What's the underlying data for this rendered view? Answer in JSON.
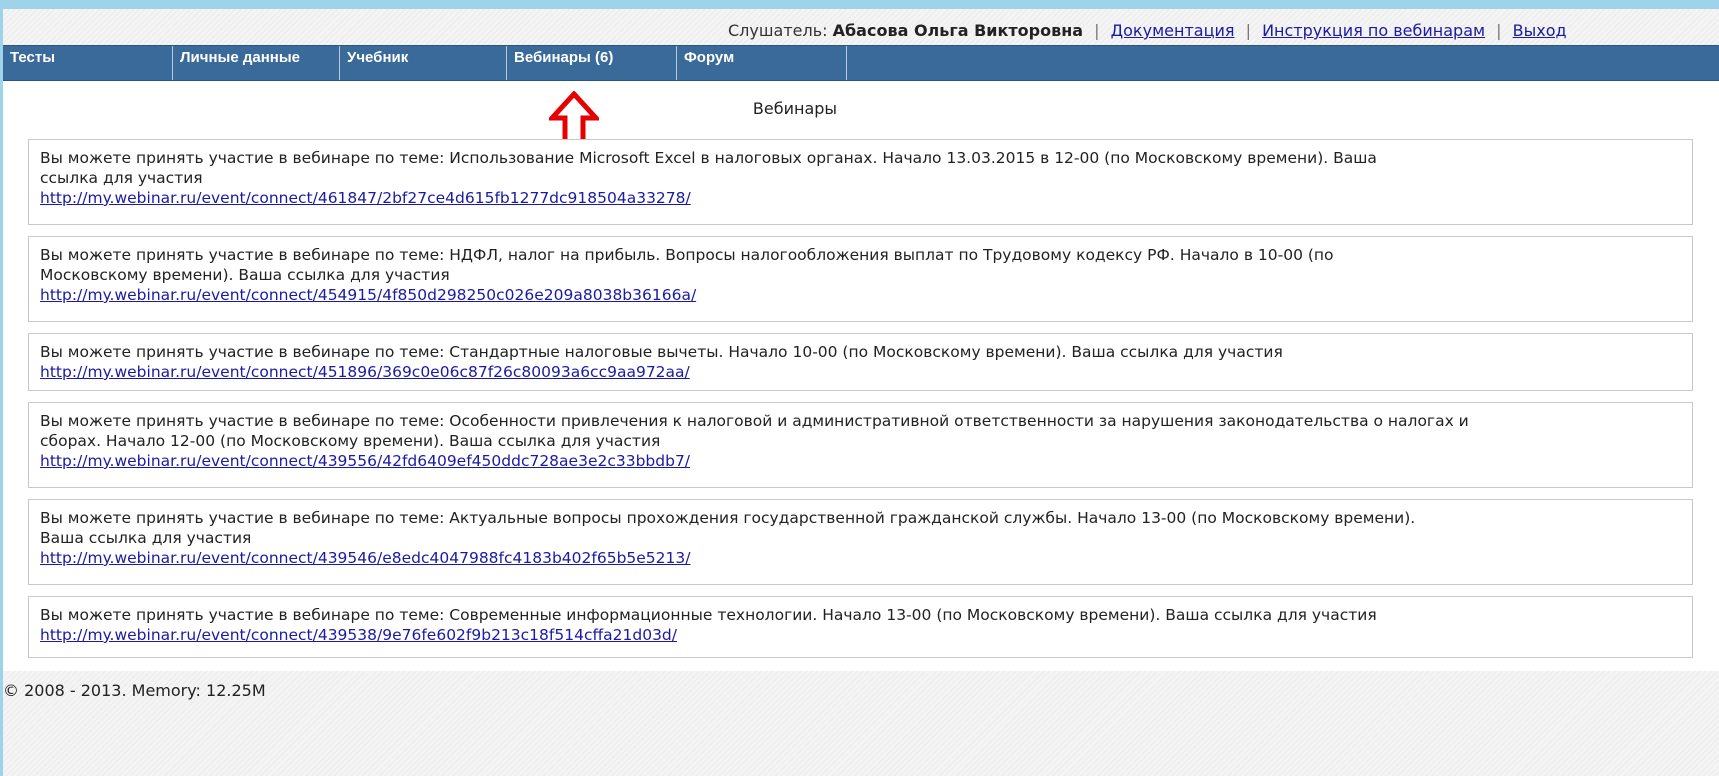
{
  "header": {
    "listener_label": "Слушатель:",
    "listener_name": "Абасова Ольга Викторовна",
    "links": [
      "Документация",
      "Инструкция по вебинарам",
      "Выход"
    ]
  },
  "nav": {
    "tabs": [
      "Тесты",
      "Личные данные",
      "Учебник",
      "Вебинары (6)",
      "Форум"
    ]
  },
  "main": {
    "title": "Вебинары",
    "webinars": [
      {
        "line1": "Вы можете принять участие в вебинаре по теме: Использование Microsoft Excel в налоговых органах. Начало 13.03.2015 в 12-00 (по Московскому времени). Ваша",
        "line2": "ссылка для участия",
        "link": "http://my.webinar.ru/event/connect/461847/2bf27ce4d615fb1277dc918504a33278/"
      },
      {
        "line1": "Вы можете принять участие в вебинаре по теме: НДФЛ, налог на прибыль. Вопросы налогообложения выплат по Трудовому кодексу РФ. Начало в 10-00 (по",
        "line2": "Московскому времени). Ваша ссылка для участия",
        "link": "http://my.webinar.ru/event/connect/454915/4f850d298250c026e209a8038b36166a/"
      },
      {
        "line1": "Вы можете принять участие в вебинаре по теме: Стандартные налоговые вычеты. Начало 10-00 (по Московскому времени). Ваша ссылка для участия",
        "line2": "",
        "link": "http://my.webinar.ru/event/connect/451896/369c0e06c87f26c80093a6cc9aa972aa/"
      },
      {
        "line1": "Вы можете принять участие в вебинаре по теме: Особенности привлечения к налоговой и административной ответственности за нарушения законодательства о налогах и",
        "line2": "сборах. Начало 12-00 (по Московскому времени). Ваша ссылка для участия",
        "link": "http://my.webinar.ru/event/connect/439556/42fd6409ef450ddc728ae3e2c33bbdb7/"
      },
      {
        "line1": "Вы можете принять участие в вебинаре по теме: Актуальные вопросы прохождения государственной гражданской службы. Начало 13-00 (по Московскому времени).",
        "line2": "Ваша ссылка для участия",
        "link": "http://my.webinar.ru/event/connect/439546/e8edc4047988fc4183b402f65b5e5213/"
      },
      {
        "line1": "Вы можете принять участие в вебинаре по теме: Современные информационные технологии. Начало 13-00 (по Московскому времени). Ваша ссылка для участия",
        "line2": "",
        "link": "http://my.webinar.ru/event/connect/439538/9e76fe602f9b213c18f514cffa21d03d/"
      }
    ]
  },
  "annotation": {
    "icon": "red-up-arrow-icon",
    "color": "#e60000"
  },
  "footer": {
    "text": "© 2008 - 2013. Memory: 12.25M"
  }
}
